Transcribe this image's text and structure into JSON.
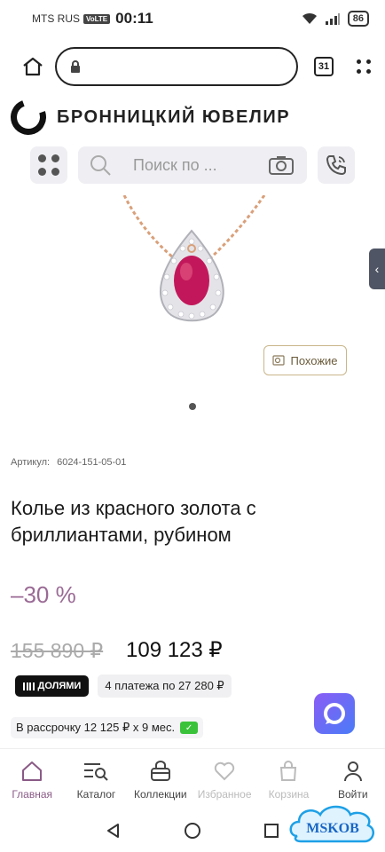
{
  "status_bar": {
    "carrier": "MTS RUS",
    "volte": "VoLTE",
    "time": "00:11",
    "battery": "86"
  },
  "browser": {
    "url": "",
    "tab_count": "31"
  },
  "site": {
    "brand": "БРОННИЦКИЙ ЮВЕЛИР",
    "search_placeholder": "Поиск по ..."
  },
  "product": {
    "similar_label": "Похожие",
    "article_label": "Артикул:",
    "article_value": "6024-151-05-01",
    "title": "Колье из красного золота с бриллиантами, рубином",
    "discount": "–30 %",
    "old_price": "155 890 ₽",
    "new_price": "109 123 ₽",
    "dolyami_label": "ДОЛЯМИ",
    "dolyami_payments": "4 платежа по 27 280 ₽",
    "installment": "В рассрочку 12 125 ₽ x 9 мес."
  },
  "bottom_nav": [
    {
      "label": "Главная",
      "icon": "home-icon"
    },
    {
      "label": "Каталог",
      "icon": "catalog-search-icon"
    },
    {
      "label": "Коллекции",
      "icon": "collections-icon"
    },
    {
      "label": "Избранное",
      "icon": "heart-icon"
    },
    {
      "label": "Корзина",
      "icon": "bag-icon"
    },
    {
      "label": "Войти",
      "icon": "user-icon"
    }
  ],
  "watermark": "MSKOB",
  "colors": {
    "accent": "#9a6a95",
    "gold": "#c9b58a",
    "ruby": "#c2185b"
  }
}
